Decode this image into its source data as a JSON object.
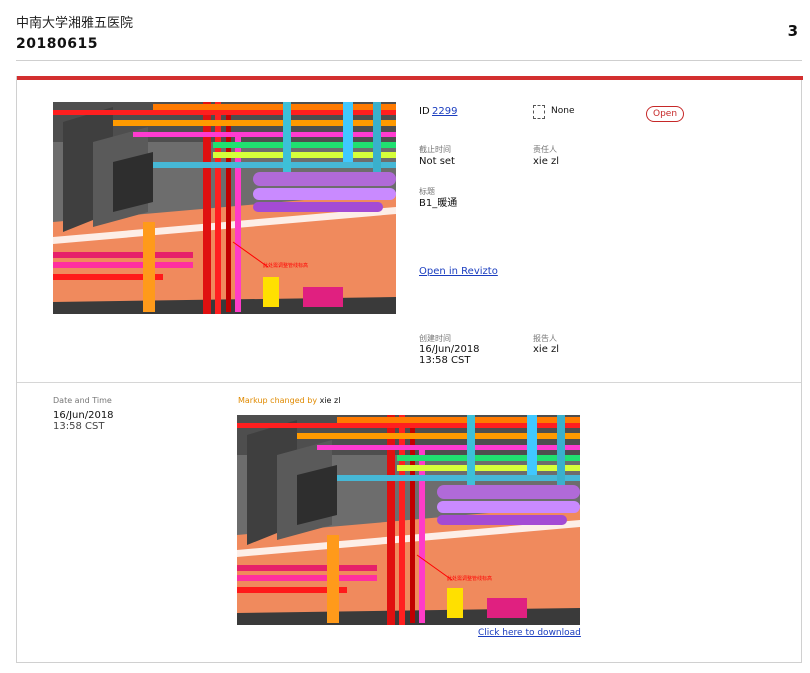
{
  "header": {
    "hospital": "中南大学湘雅五医院",
    "report_date": "20180615",
    "page_number": "3"
  },
  "issue": {
    "id_label": "ID",
    "id_value": "2299",
    "type_label": "None",
    "status": "Open",
    "deadline_label": "截止时间",
    "deadline_value": "Not set",
    "assignee_label": "责任人",
    "assignee_value": "xie zl",
    "title_label": "标题",
    "title_value": "B1_暖通",
    "open_link": "Open in Revizto",
    "created_label": "创建时间",
    "created_date": "16/Jun/2018",
    "created_time": "13:58 CST",
    "reporter_label": "报告人",
    "reporter_value": "xie zl",
    "snapshot_annotation": "此处需调整管线标高"
  },
  "history": {
    "label": "Date and Time",
    "date": "16/Jun/2018",
    "time": "13:58 CST",
    "markup_text": "Markup changed by",
    "markup_user": "xie zl",
    "download_link": "Click here to download"
  },
  "colors": {
    "accent": "#d32f2f",
    "status": "#c62828",
    "link": "#1a3dbf",
    "markup": "#e08a00"
  }
}
